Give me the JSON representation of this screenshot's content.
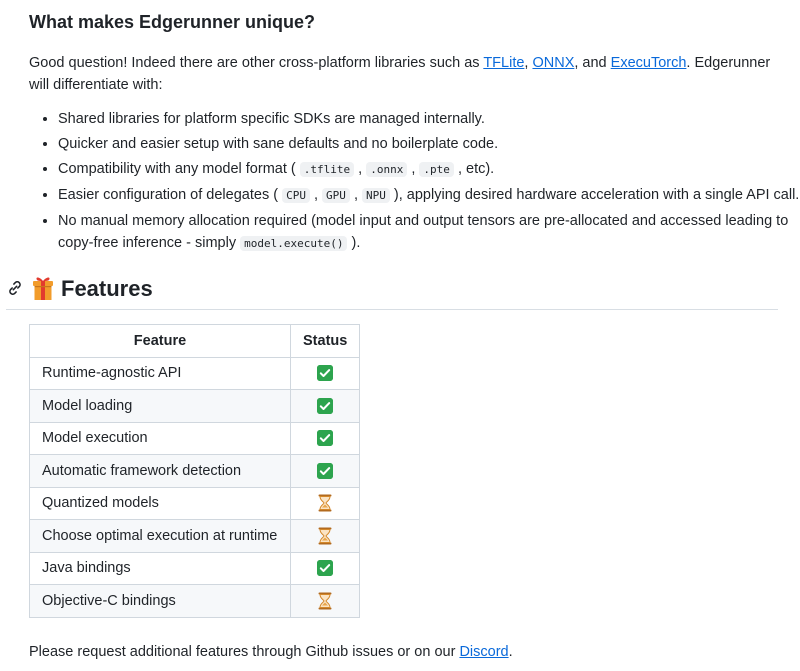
{
  "section": {
    "heading": "What makes Edgerunner unique?",
    "intro": {
      "before": "Good question! Indeed there are other cross-platform libraries such as ",
      "link1": "TFLite",
      "sep1": ", ",
      "link2": "ONNX",
      "sep2": ", and ",
      "link3": "ExecuTorch",
      "after": ". Edgerunner will differentiate with:"
    },
    "bullets": {
      "b1": "Shared libraries for platform specific SDKs are managed internally.",
      "b2": "Quicker and easier setup with sane defaults and no boilerplate code.",
      "b3": {
        "pre": "Compatibility with any model format ( ",
        "c1": ".tflite",
        "s1": " , ",
        "c2": ".onnx",
        "s2": " , ",
        "c3": ".pte",
        "post": " , etc)."
      },
      "b4": {
        "pre": "Easier configuration of delegates ( ",
        "c1": "CPU",
        "s1": " , ",
        "c2": "GPU",
        "s2": " , ",
        "c3": "NPU",
        "post": " ), applying desired hardware acceleration with a single API call."
      },
      "b5": {
        "pre": "No manual memory allocation required (model input and output tensors are pre-allocated and accessed leading to copy-free inference - simply ",
        "c1": "model.execute()",
        "post": " )."
      }
    }
  },
  "features": {
    "title": "Features",
    "icons": {
      "anchor": "link-icon",
      "gift": "gift-icon",
      "done": "check-mark-icon",
      "pending": "hourglass-icon"
    },
    "table": {
      "headers": {
        "feature": "Feature",
        "status": "Status"
      },
      "rows": [
        {
          "feature": "Runtime-agnostic API",
          "status": "done"
        },
        {
          "feature": "Model loading",
          "status": "done"
        },
        {
          "feature": "Model execution",
          "status": "done"
        },
        {
          "feature": "Automatic framework detection",
          "status": "done"
        },
        {
          "feature": "Quantized models",
          "status": "pending"
        },
        {
          "feature": "Choose optimal execution at runtime",
          "status": "pending"
        },
        {
          "feature": "Java bindings",
          "status": "done"
        },
        {
          "feature": "Objective-C bindings",
          "status": "pending"
        }
      ]
    }
  },
  "footer": {
    "before": "Please request additional features through Github issues or on our ",
    "link": "Discord",
    "after": "."
  },
  "colors": {
    "link": "#0969da",
    "check": "#2da44e",
    "hourglass": "#d4882a",
    "text": "#1f2328"
  }
}
